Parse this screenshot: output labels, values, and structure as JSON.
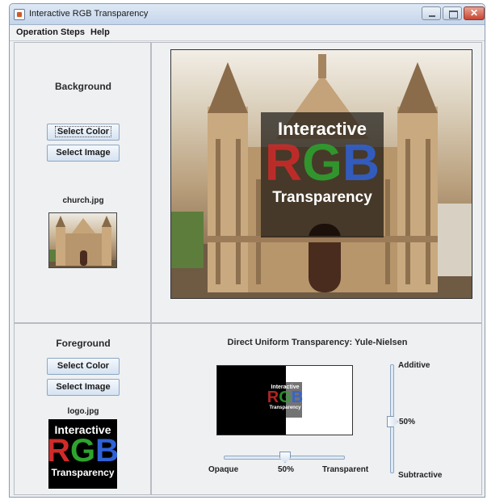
{
  "window": {
    "title": "Interactive RGB Transparency"
  },
  "menu": [
    "Operation Steps",
    "Help"
  ],
  "background_panel": {
    "heading": "Background",
    "select_color_label": "Select Color",
    "select_image_label": "Select Image",
    "filename": "church.jpg"
  },
  "foreground_panel": {
    "heading": "Foreground",
    "select_color_label": "Select Color",
    "select_image_label": "Select Image",
    "filename": "logo.jpg"
  },
  "logo": {
    "line1": "Interactive",
    "r": "R",
    "g": "G",
    "b": "B",
    "line3": "Transparency"
  },
  "controls": {
    "title": "Direct Uniform Transparency: Yule-Nielsen",
    "opacity_slider": {
      "left_label": "Opaque",
      "value_label": "50%",
      "right_label": "Transparent",
      "value": 0.5
    },
    "blend_slider": {
      "top_label": "Additive",
      "value_label": "50%",
      "bottom_label": "Subtractive",
      "value": 0.5
    }
  },
  "colors": {
    "title_bar": "#c4d5ea",
    "red": "#d02a2a",
    "green": "#2ea42e",
    "blue": "#2f62d6"
  }
}
